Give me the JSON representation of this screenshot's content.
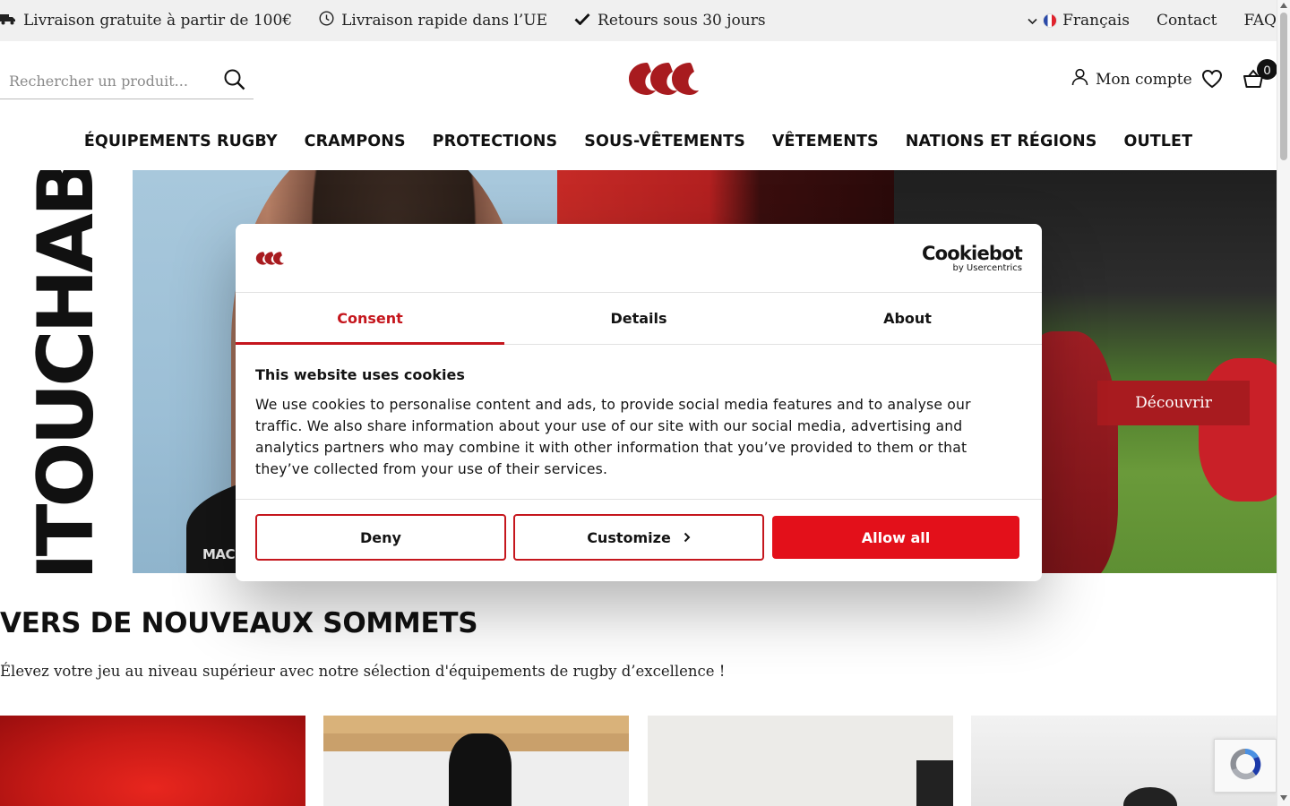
{
  "topbar": {
    "usps": [
      {
        "icon": "truck-icon",
        "label": "Livraison gratuite à partir de 100€"
      },
      {
        "icon": "clock-icon",
        "label": "Livraison rapide dans l’UE"
      },
      {
        "icon": "check-icon",
        "label": "Retours sous 30 jours"
      }
    ],
    "language": "Français",
    "contact": "Contact",
    "faq": "FAQ"
  },
  "header": {
    "search_placeholder": "Rechercher un produit...",
    "account_label": "Mon compte",
    "cart_count": "0",
    "brand_color": "#a81b1f"
  },
  "nav": {
    "items": [
      "ÉQUIPEMENTS RUGBY",
      "CRAMPONS",
      "PROTECTIONS",
      "SOUS-VÊTEMENTS",
      "VÊTEMENTS",
      "NATIONS ET RÉGIONS",
      "OUTLET"
    ]
  },
  "hero": {
    "title": "UNTOUCHABLE",
    "caption": "MACK",
    "cta": "Découvrir"
  },
  "section": {
    "title": "VERS DE NOUVEAUX SOMMETS",
    "subtitle": "Élevez votre jeu au niveau supérieur avec notre sélection d'équipements de rugby d’excellence !"
  },
  "cookie_dialog": {
    "provider_name": "Cookiebot",
    "provider_sub": "by Usercentrics",
    "tabs": [
      "Consent",
      "Details",
      "About"
    ],
    "active_tab": "Consent",
    "title": "This website uses cookies",
    "text": "We use cookies to personalise content and ads, to provide social media features and to analyse our traffic. We also share information about your use of our site with our social media, advertising and analytics partners who may combine it with other information that you’ve provided to them or that they’ve collected from your use of their services.",
    "deny": "Deny",
    "customize": "Customize",
    "allow_all": "Allow all",
    "accent_color": "#c5161d",
    "allow_color": "#e3101a"
  }
}
